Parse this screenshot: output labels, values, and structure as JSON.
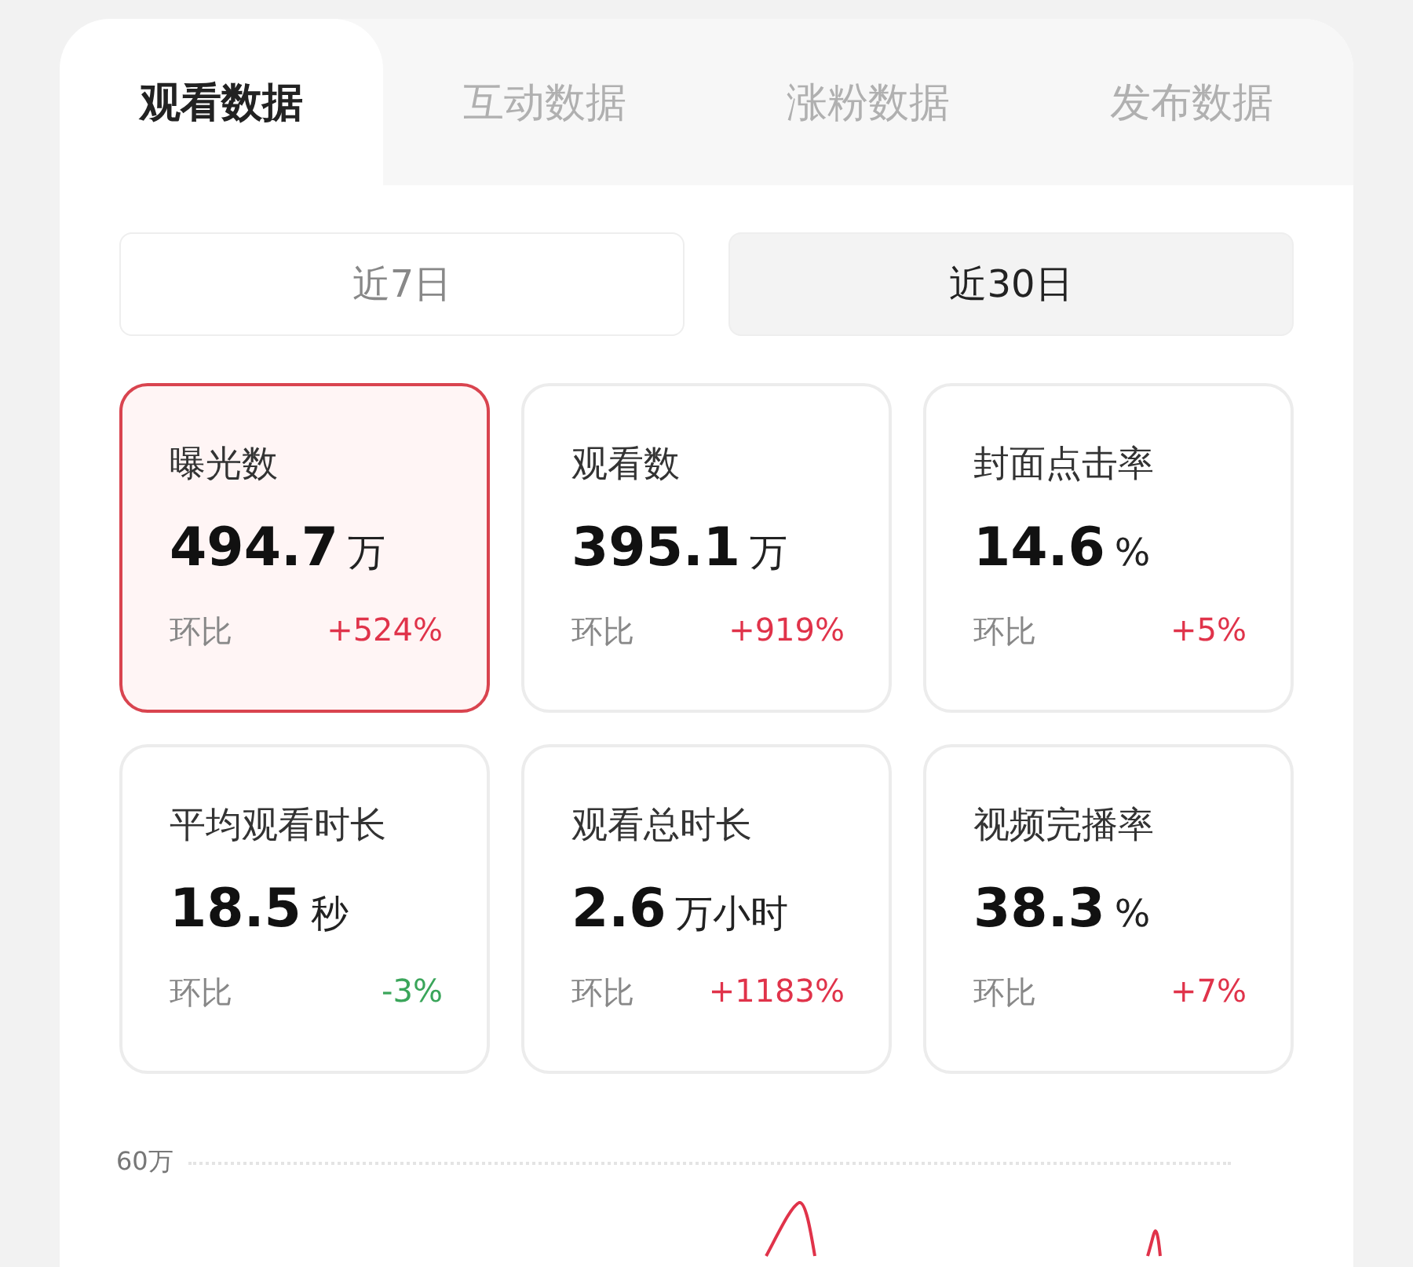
{
  "tabs": [
    {
      "label": "观看数据",
      "selected": true
    },
    {
      "label": "互动数据",
      "selected": false
    },
    {
      "label": "涨粉数据",
      "selected": false
    },
    {
      "label": "发布数据",
      "selected": false
    }
  ],
  "periods": [
    {
      "label": "近7日",
      "selected": false
    },
    {
      "label": "近30日",
      "selected": true
    }
  ],
  "metrics": [
    {
      "title": "曝光数",
      "value": "494.7",
      "unit": "万",
      "compare_label": "环比",
      "change": "+524%",
      "color": "#e0334a",
      "selected": true
    },
    {
      "title": "观看数",
      "value": "395.1",
      "unit": "万",
      "compare_label": "环比",
      "change": "+919%",
      "color": "#e0334a",
      "selected": false
    },
    {
      "title": "封面点击率",
      "value": "14.6",
      "unit": "%",
      "compare_label": "环比",
      "change": "+5%",
      "color": "#e0334a",
      "selected": false
    },
    {
      "title": "平均观看时长",
      "value": "18.5",
      "unit": "秒",
      "compare_label": "环比",
      "change": "-3%",
      "color": "#3aa55a",
      "selected": false
    },
    {
      "title": "观看总时长",
      "value": "2.6",
      "unit": "万小时",
      "compare_label": "环比",
      "change": "+1183%",
      "color": "#e0334a",
      "selected": false
    },
    {
      "title": "视频完播率",
      "value": "38.3",
      "unit": "%",
      "compare_label": "环比",
      "change": "+7%",
      "color": "#e0334a",
      "selected": false
    }
  ],
  "chart": {
    "axis_label": "60万"
  }
}
